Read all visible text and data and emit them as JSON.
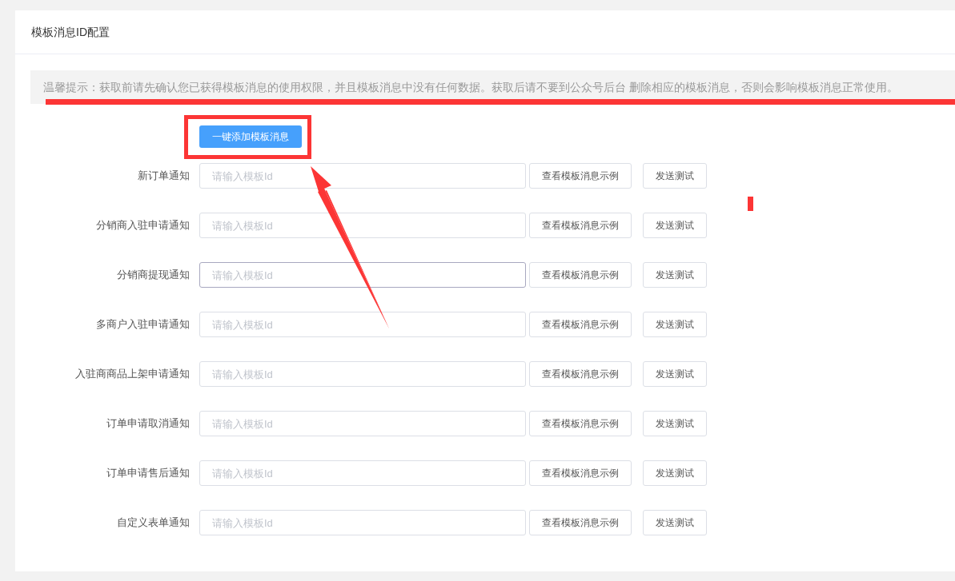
{
  "panel": {
    "title": "模板消息ID配置"
  },
  "notice": "温馨提示：获取前请先确认您已获得模板消息的使用权限，并且模板消息中没有任何数据。获取后请不要到公众号后台 删除相应的模板消息，否则会影响模板消息正常使用。",
  "add_button": "一键添加模板消息",
  "rows": [
    {
      "label": "新订单通知",
      "placeholder": "请输入模板Id",
      "focused": false,
      "example_button": "查看模板消息示例",
      "test_button": "发送测试"
    },
    {
      "label": "分销商入驻申请通知",
      "placeholder": "请输入模板Id",
      "focused": false,
      "example_button": "查看模板消息示例",
      "test_button": "发送测试"
    },
    {
      "label": "分销商提现通知",
      "placeholder": "请输入模板Id",
      "focused": true,
      "example_button": "查看模板消息示例",
      "test_button": "发送测试"
    },
    {
      "label": "多商户入驻申请通知",
      "placeholder": "请输入模板Id",
      "focused": false,
      "example_button": "查看模板消息示例",
      "test_button": "发送测试"
    },
    {
      "label": "入驻商商品上架申请通知",
      "placeholder": "请输入模板Id",
      "focused": false,
      "example_button": "查看模板消息示例",
      "test_button": "发送测试"
    },
    {
      "label": "订单申请取消通知",
      "placeholder": "请输入模板Id",
      "focused": false,
      "example_button": "查看模板消息示例",
      "test_button": "发送测试"
    },
    {
      "label": "订单申请售后通知",
      "placeholder": "请输入模板Id",
      "focused": false,
      "example_button": "查看模板消息示例",
      "test_button": "发送测试"
    },
    {
      "label": "自定义表单通知",
      "placeholder": "请输入模板Id",
      "focused": false,
      "example_button": "查看模板消息示例",
      "test_button": "发送测试"
    }
  ]
}
